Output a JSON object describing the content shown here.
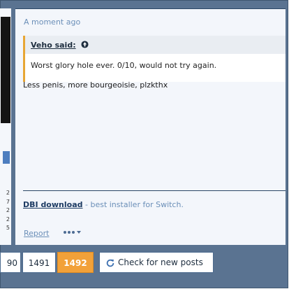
{
  "post": {
    "timestamp": "A moment ago",
    "quote": {
      "author_label": "Veho said:",
      "text": "Worst glory hole ever. 0/10, would not try again."
    },
    "message": "Less penis, more bourgeoisie, plzkthx",
    "signature": {
      "link_text": "DBI download",
      "rest": " - best installer for Switch."
    },
    "actions": {
      "report_label": "Report",
      "more_icon": "ellipsis-dropdown-icon"
    }
  },
  "left_edge_numbers": [
    "2",
    "7",
    "2",
    "2",
    "5"
  ],
  "pagination": {
    "prev_page_partial": "90",
    "page": "1491",
    "current_page": "1492",
    "check_label": "Check for new posts",
    "check_icon": "refresh-icon"
  },
  "colors": {
    "accent_orange": "#f2a139",
    "frame_blue": "#5a7391",
    "link_blue": "#6b8fb8"
  }
}
